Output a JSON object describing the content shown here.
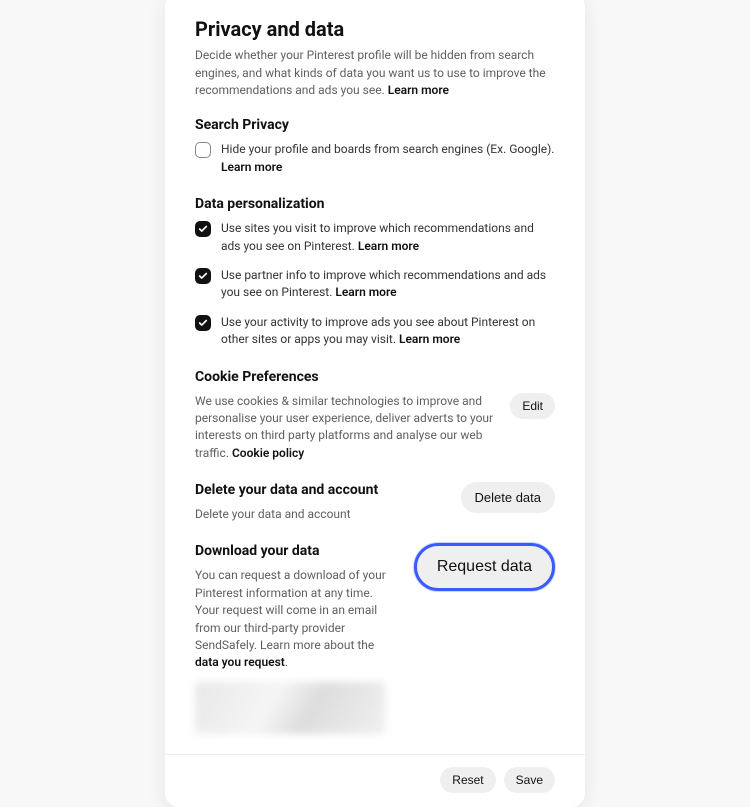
{
  "header": {
    "title": "Privacy and data",
    "subtitle_prefix": "Decide whether your Pinterest profile will be hidden from search engines, and what kinds of data you want us to use to improve the recommendations and ads you see. ",
    "learn_more": "Learn more"
  },
  "search_privacy": {
    "heading": "Search Privacy",
    "item_text": "Hide your profile and boards from search engines (Ex. Google). ",
    "learn_more": "Learn more",
    "checked": false
  },
  "data_personalization": {
    "heading": "Data personalization",
    "items": [
      {
        "text": "Use sites you visit to improve which recommendations and ads you see on Pinterest. ",
        "learn_more": "Learn more",
        "checked": true
      },
      {
        "text": "Use partner info to improve which recommendations and ads you see on Pinterest. ",
        "learn_more": "Learn more",
        "checked": true
      },
      {
        "text": "Use your activity to improve ads you see about Pinterest on other sites or apps you may visit. ",
        "learn_more": "Learn more",
        "checked": true
      }
    ]
  },
  "cookies": {
    "heading": "Cookie Preferences",
    "desc_prefix": "We use cookies & similar technologies to improve and personalise your user experience, deliver adverts to your interests on third party platforms and analyse our web traffic. ",
    "policy_link": "Cookie policy",
    "button": "Edit"
  },
  "delete": {
    "heading": "Delete your data and account",
    "desc": "Delete your data and account",
    "button": "Delete data"
  },
  "download": {
    "heading": "Download your data",
    "desc_prefix": "You can request a download of your Pinterest information at any time. Your request will come in an email from our third-party provider SendSafely. Learn more about the ",
    "desc_link": "data you request",
    "desc_suffix": ".",
    "button": "Request data"
  },
  "footer": {
    "reset": "Reset",
    "save": "Save"
  }
}
